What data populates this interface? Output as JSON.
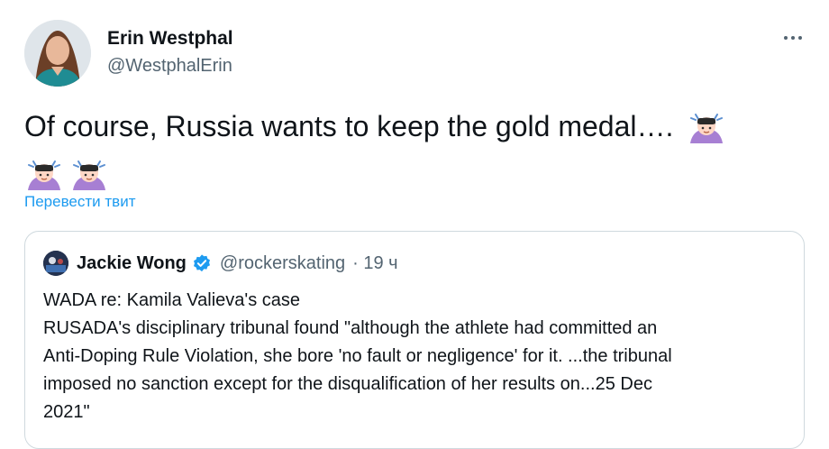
{
  "author": {
    "name": "Erin Westphal",
    "handle": "@WestphalErin"
  },
  "tweet": {
    "text": "Of course, Russia wants to keep the gold medal…. ",
    "emoji_name": "person-bowing-emoji",
    "translate_label": "Перевести твит"
  },
  "quoted": {
    "name": "Jackie Wong",
    "handle": "@rockerskating",
    "time": "· 19 ч",
    "lines": [
      "WADA re: Kamila Valieva's case",
      "RUSADA's disciplinary tribunal found \"although the athlete had committed an",
      "Anti-Doping Rule Violation, she bore 'no fault or negligence' for it. ...the tribunal",
      "imposed no sanction except for the disqualification of her results on...25 Dec",
      "2021\""
    ]
  },
  "icons": {
    "more": "more-options-icon",
    "verified": "verified-badge-icon"
  },
  "colors": {
    "accent": "#1d9bf0",
    "secondary_text": "#536471",
    "border": "#cfd9de"
  }
}
